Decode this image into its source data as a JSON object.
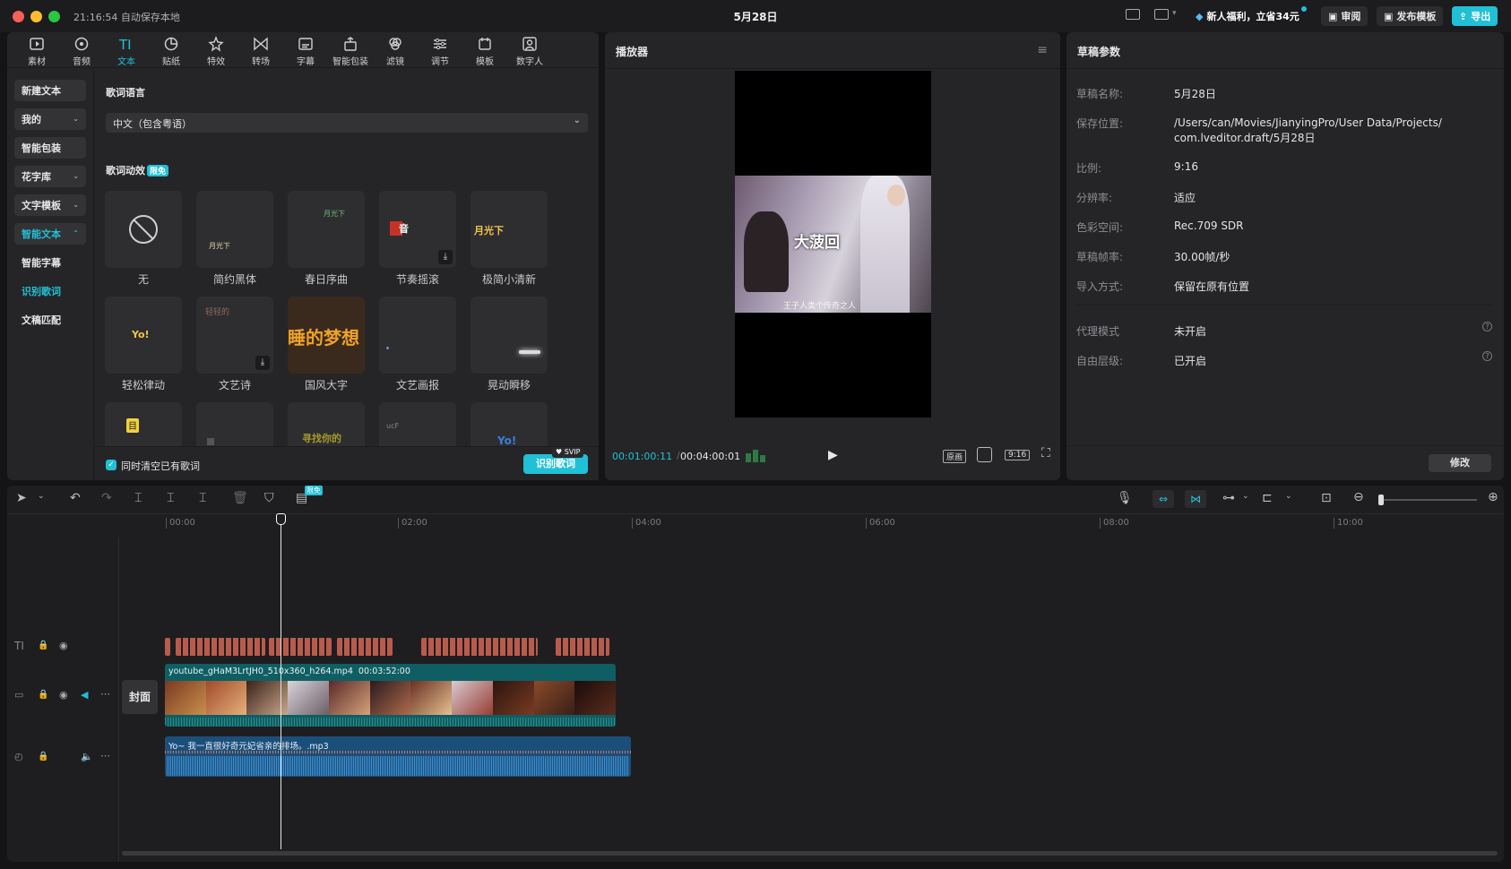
{
  "window": {
    "time_status": "21:16:54 自动保存本地",
    "title": "5月28日",
    "promo": "新人福利，立省34元",
    "review_btn": "审阅",
    "publish_btn": "发布模板",
    "export_btn": "导出"
  },
  "toolbar": {
    "tabs": [
      {
        "label": "素材",
        "icon": "media-icon"
      },
      {
        "label": "音频",
        "icon": "audio-icon"
      },
      {
        "label": "文本",
        "icon": "text-icon"
      },
      {
        "label": "贴纸",
        "icon": "sticker-icon"
      },
      {
        "label": "特效",
        "icon": "effects-icon"
      },
      {
        "label": "转场",
        "icon": "transition-icon"
      },
      {
        "label": "字幕",
        "icon": "caption-icon"
      },
      {
        "label": "智能包装",
        "icon": "smart-pack-icon"
      },
      {
        "label": "滤镜",
        "icon": "filter-icon"
      },
      {
        "label": "调节",
        "icon": "adjust-icon"
      },
      {
        "label": "模板",
        "icon": "template-icon"
      },
      {
        "label": "数字人",
        "icon": "avatar-icon"
      }
    ],
    "active_tab": "文本"
  },
  "sidebar": {
    "items": [
      "新建文本",
      "我的",
      "智能包装",
      "花字库",
      "文字模板",
      "智能文本",
      "智能字幕",
      "识别歌词",
      "文稿匹配"
    ],
    "active_item": "识别歌词"
  },
  "lyrics": {
    "lang_label": "歌词语言",
    "lang_value": "中文（包含粤语）",
    "anim_label": "歌词动效",
    "anim_badge": "限免",
    "cards": [
      {
        "label": "无",
        "preview": ""
      },
      {
        "label": "简约黑体",
        "preview": "月光下"
      },
      {
        "label": "春日序曲",
        "preview": "月光下"
      },
      {
        "label": "节奏摇滚",
        "preview": "音"
      },
      {
        "label": "极简小清新",
        "preview": "月光下"
      },
      {
        "label": "轻松律动",
        "preview": "Yo!"
      },
      {
        "label": "文艺诗",
        "preview": "轻轻的"
      },
      {
        "label": "国风大字",
        "preview": "睡的梦想"
      },
      {
        "label": "文艺画报",
        "preview": ""
      },
      {
        "label": "晃动瞬移",
        "preview": ""
      },
      {
        "label": "",
        "preview": "目"
      },
      {
        "label": "",
        "preview": ""
      },
      {
        "label": "",
        "preview": "寻找你的"
      },
      {
        "label": "",
        "preview": "ucF"
      },
      {
        "label": "",
        "preview": "Yo!"
      }
    ],
    "clear_checkbox": "同时清空已有歌词",
    "recognize_btn": "识别歌词",
    "svip_badge": "SVIP"
  },
  "player": {
    "title": "播放器",
    "current_time": "00:01:00:11",
    "total_time": "00:04:00:01",
    "video_caption": "大菠回",
    "video_subtitle": "王子人类个传奇之人",
    "btn_original": "原画",
    "btn_ratio": "9:16"
  },
  "draft": {
    "title": "草稿参数",
    "rows": [
      {
        "k": "草稿名称:",
        "v": "5月28日"
      },
      {
        "k": "保存位置:",
        "v": "/Users/can/Movies/JianyingPro/User Data/Projects/ com.lveditor.draft/5月28日"
      },
      {
        "k": "比例:",
        "v": "9:16"
      },
      {
        "k": "分辨率:",
        "v": "适应"
      },
      {
        "k": "色彩空间:",
        "v": "Rec.709 SDR"
      },
      {
        "k": "草稿帧率:",
        "v": "30.00帧/秒"
      },
      {
        "k": "导入方式:",
        "v": "保留在原有位置"
      }
    ],
    "rows2": [
      {
        "k": "代理模式",
        "v": "未开启"
      },
      {
        "k": "自由层级:",
        "v": "已开启"
      }
    ],
    "modify_btn": "修改"
  },
  "timeline": {
    "toolbar_badge": "限免",
    "ticks": [
      "00:00",
      "02:00",
      "04:00",
      "06:00",
      "08:00",
      "10:00"
    ],
    "cover_label": "封面",
    "video_clip_name": "youtube_gHaM3LrtJH0_510x360_h264.mp4",
    "video_clip_duration": "00:03:52:00",
    "audio_clip_name": "Yo~ 我一直很好奇元妃省亲的排场。.mp3"
  },
  "colors": {
    "accent": "#21c0d6",
    "text_clip": "#b95b4c",
    "video_clip": "#0f5e63",
    "audio_clip": "#1b4f7a"
  }
}
